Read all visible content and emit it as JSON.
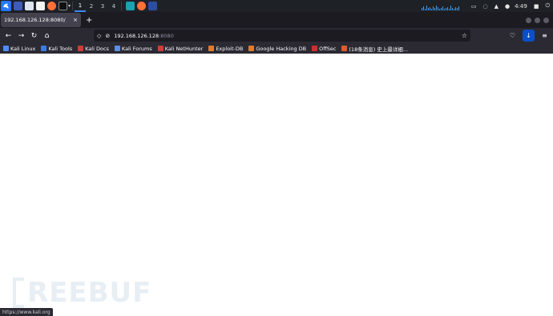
{
  "taskbar": {
    "workspaces": [
      "1",
      "2",
      "3",
      "4"
    ],
    "time": "4:49"
  },
  "tab": {
    "title": "192.168.126.128:8080/",
    "close": "×",
    "new_tab": "+"
  },
  "urlbar": {
    "host": "192.168.126.128",
    "port": ":8080"
  },
  "bookmarks": [
    {
      "label": "Kali Linux",
      "color": "#4f8cff"
    },
    {
      "label": "Kali Tools",
      "color": "#3d7be0"
    },
    {
      "label": "Kali Docs",
      "color": "#d33b3b"
    },
    {
      "label": "Kali Forums",
      "color": "#5a8ee8"
    },
    {
      "label": "Kali NetHunter",
      "color": "#d33b3b"
    },
    {
      "label": "Exploit-DB",
      "color": "#e07b2e"
    },
    {
      "label": "Google Hacking DB",
      "color": "#e07b2e"
    },
    {
      "label": "OffSec",
      "color": "#cc2f2f"
    },
    {
      "label": "(18条消息) 史上最详细...",
      "color": "#e25a2a"
    }
  ],
  "watermark": "REEBUF",
  "status_url": "https://www.kali.org"
}
